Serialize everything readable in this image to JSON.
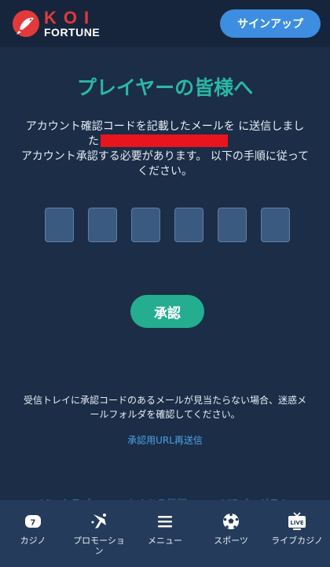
{
  "header": {
    "logo_top": "KOI",
    "logo_bottom": "FORTUNE",
    "signup_label": "サインアップ"
  },
  "main": {
    "title": "プレイヤーの皆様へ",
    "message_line1": "アカウント確認コードを記載したメールを に送信しまし",
    "message_line2": "た",
    "message_line3": "アカウント承認する必要があります。 以下の手順に従って",
    "message_line4": "ください。",
    "code_boxes": [
      "",
      "",
      "",
      "",
      "",
      ""
    ],
    "confirm_label": "承認",
    "hint_line1": "受信トレイに承認コードのあるメールが見当たらない場合、迷惑メ",
    "hint_line2": "ールフォルダを確認してください。",
    "resend_label": "承認用URL再送信"
  },
  "footer_links": [
    "Vip クラブ",
    "よくある質問",
    "VIPプログラム"
  ],
  "bottom_nav": [
    {
      "label": "カジノ",
      "icon": "casino-icon"
    },
    {
      "label": "プロモーション",
      "icon": "promotions-icon"
    },
    {
      "label": "メニュー",
      "icon": "menu-icon"
    },
    {
      "label": "スポーツ",
      "icon": "soccer-ball-icon"
    },
    {
      "label": "ライブカジノ",
      "icon": "live-tv-icon"
    }
  ],
  "colors": {
    "background": "#1b2d47",
    "accent_teal": "#2ab8a3",
    "button_green": "#24ae8f",
    "signup_blue": "#3d8ee0",
    "redaction": "#e8141e",
    "link_blue": "#4ea3e8"
  }
}
